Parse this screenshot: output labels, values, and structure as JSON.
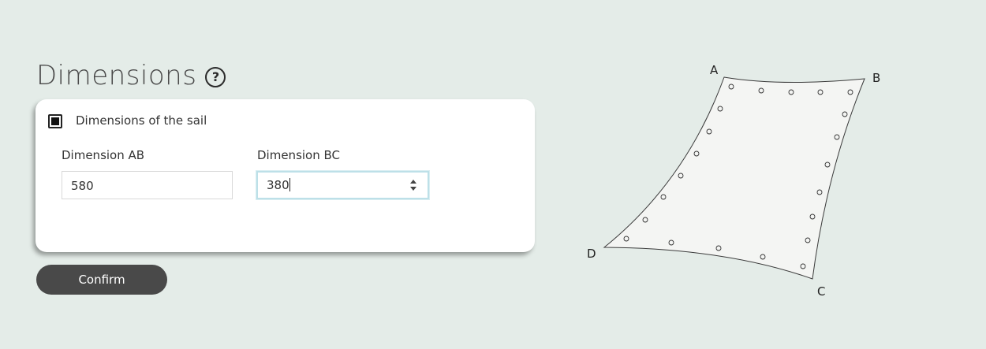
{
  "header": {
    "title": "Dimensions",
    "help_icon": "?"
  },
  "card": {
    "checkbox_label": "Dimensions of the sail",
    "checkbox_checked": true,
    "fields": [
      {
        "label": "Dimension AB",
        "value": "580"
      },
      {
        "label": "Dimension BC",
        "value": "380"
      }
    ]
  },
  "actions": {
    "confirm_label": "Confirm"
  },
  "diagram": {
    "corners": [
      "A",
      "B",
      "C",
      "D"
    ]
  },
  "colors": {
    "background": "#e4ece8",
    "card": "#ffffff",
    "button": "#494949",
    "focus_border": "#bde0e8",
    "sail_fill": "#f4f5f3"
  }
}
